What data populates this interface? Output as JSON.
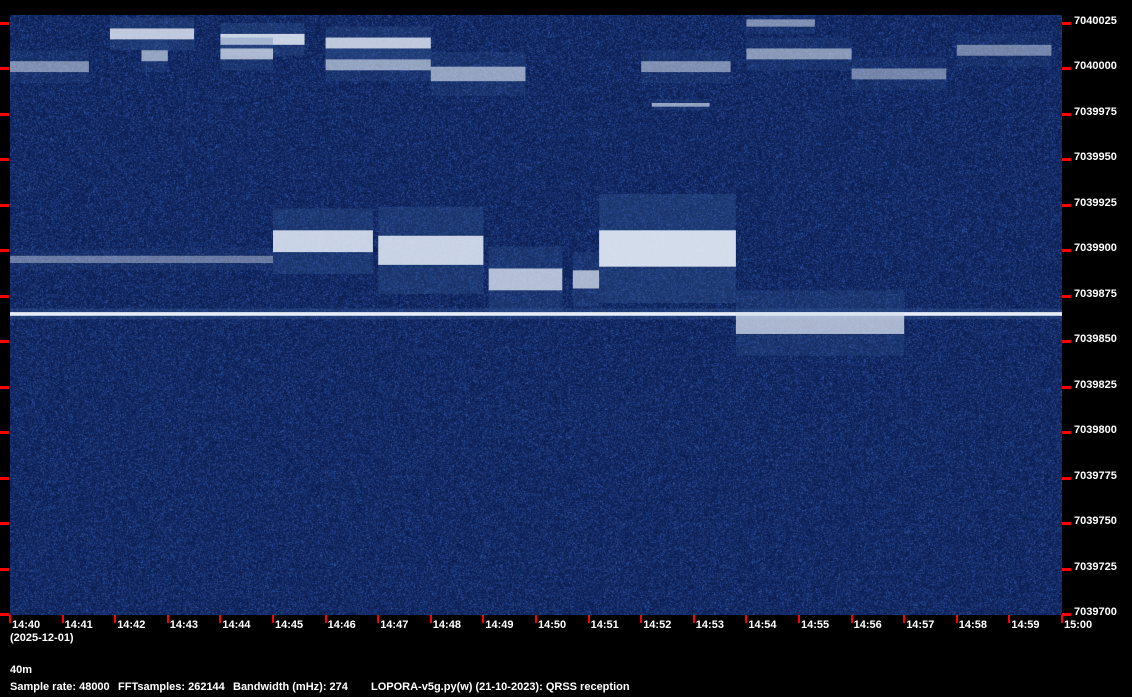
{
  "chart_data": {
    "type": "heatmap",
    "subtype": "spectrogram",
    "xlabel": "",
    "ylabel": "",
    "x_ticks": [
      "14:40",
      "14:41",
      "14:42",
      "14:43",
      "14:44",
      "14:45",
      "14:46",
      "14:47",
      "14:48",
      "14:49",
      "14:50",
      "14:51",
      "14:52",
      "14:53",
      "14:54",
      "14:55",
      "14:56",
      "14:57",
      "14:58",
      "14:59",
      "15:00"
    ],
    "y_ticks": [
      "7040025",
      "7040000",
      "7039975",
      "7039950",
      "7039925",
      "7039900",
      "7039875",
      "7039850",
      "7039825",
      "7039800",
      "7039775",
      "7039750",
      "7039725",
      "7039700"
    ],
    "xlim": [
      "14:40",
      "15:00"
    ],
    "ylim": [
      7039700,
      7040025
    ],
    "colors": {
      "background": "#0b1f55",
      "signal": "#e8eef8",
      "tick": "#ff0000"
    },
    "signals": [
      {
        "start": "14:40",
        "end": "15:00",
        "freq": 7039865,
        "spread": 1,
        "level": 1.0
      },
      {
        "start": "14:45",
        "end": "14:46.9",
        "freq": 7039905,
        "spread": 6,
        "level": 0.85
      },
      {
        "start": "14:47",
        "end": "14:49",
        "freq": 7039900,
        "spread": 8,
        "level": 0.85
      },
      {
        "start": "14:49.1",
        "end": "14:50.5",
        "freq": 7039884,
        "spread": 6,
        "level": 0.75
      },
      {
        "start": "14:50.7",
        "end": "14:51.2",
        "freq": 7039884,
        "spread": 5,
        "level": 0.7
      },
      {
        "start": "14:51.2",
        "end": "14:53.8",
        "freq": 7039901,
        "spread": 10,
        "level": 0.9
      },
      {
        "start": "14:53.8",
        "end": "14:57",
        "freq": 7039860,
        "spread": 6,
        "level": 0.7
      },
      {
        "start": "14:40",
        "end": "14:45",
        "freq": 7039895,
        "spread": 2,
        "level": 0.4
      },
      {
        "start": "14:40",
        "end": "14:41.5",
        "freq": 7040001,
        "spread": 3,
        "level": 0.5
      },
      {
        "start": "14:41.9",
        "end": "14:43.5",
        "freq": 7040019,
        "spread": 3,
        "level": 0.8
      },
      {
        "start": "14:42.5",
        "end": "14:43",
        "freq": 7040007,
        "spread": 3,
        "level": 0.6
      },
      {
        "start": "14:44",
        "end": "14:45.6",
        "freq": 7040016,
        "spread": 3,
        "level": 0.85
      },
      {
        "start": "14:44",
        "end": "14:45",
        "freq": 7040008,
        "spread": 3,
        "level": 0.7
      },
      {
        "start": "14:46",
        "end": "14:48",
        "freq": 7040014,
        "spread": 3,
        "level": 0.8
      },
      {
        "start": "14:46",
        "end": "14:48",
        "freq": 7040002,
        "spread": 3,
        "level": 0.6
      },
      {
        "start": "14:48",
        "end": "14:49.8",
        "freq": 7039997,
        "spread": 4,
        "level": 0.6
      },
      {
        "start": "14:52.2",
        "end": "14:53.3",
        "freq": 7039980,
        "spread": 1,
        "level": 0.6
      },
      {
        "start": "14:52",
        "end": "14:53.7",
        "freq": 7040001,
        "spread": 3,
        "level": 0.5
      },
      {
        "start": "14:54",
        "end": "14:56",
        "freq": 7040008,
        "spread": 3,
        "level": 0.55
      },
      {
        "start": "14:56",
        "end": "14:57.8",
        "freq": 7039997,
        "spread": 3,
        "level": 0.45
      },
      {
        "start": "14:58",
        "end": "14:59.8",
        "freq": 7040010,
        "spread": 3,
        "level": 0.45
      },
      {
        "start": "14:54",
        "end": "14:55.3",
        "freq": 7040025,
        "spread": 2,
        "level": 0.5
      }
    ]
  },
  "date_label": "(2025-12-01)",
  "band_label": "40m",
  "footer": {
    "sample_rate": "Sample rate: 48000",
    "fft_samples": "FFTsamples: 262144",
    "bandwidth": "Bandwidth (mHz): 274",
    "program": "LOPORA-v5g.py(w) (21-10-2023): QRSS reception"
  }
}
